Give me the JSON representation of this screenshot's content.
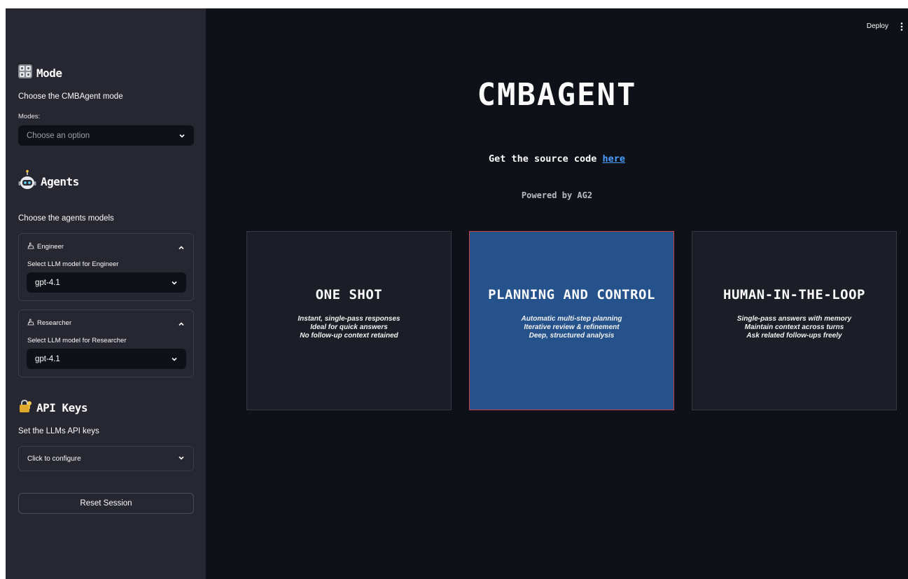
{
  "sidebar": {
    "mode": {
      "heading": "Mode",
      "description": "Choose the CMBAgent mode",
      "select_label": "Modes:",
      "select_placeholder": "Choose an option"
    },
    "agents": {
      "heading": "Agents",
      "description": "Choose the agents models",
      "engineer": {
        "title": "Engineer",
        "label": "Select LLM model for Engineer",
        "value": "gpt-4.1"
      },
      "researcher": {
        "title": "Researcher",
        "label": "Select LLM model for Researcher",
        "value": "gpt-4.1"
      }
    },
    "api_keys": {
      "heading": "API Keys",
      "description": "Set the LLMs API keys",
      "expander_label": "Click to configure"
    },
    "reset_label": "Reset Session"
  },
  "header": {
    "deploy_label": "Deploy"
  },
  "main": {
    "title": "CMBAGENT",
    "source_prefix": "Get the source code ",
    "source_link": "here",
    "powered": "Powered by AG2",
    "cards": [
      {
        "title": "ONE SHOT",
        "lines": [
          "Instant, single-pass responses",
          "Ideal for quick answers",
          "No follow-up context retained"
        ]
      },
      {
        "title": "PLANNING AND CONTROL",
        "lines": [
          "Automatic multi-step planning",
          "Iterative review & refinement",
          "Deep, structured analysis"
        ]
      },
      {
        "title": "HUMAN-IN-THE-LOOP",
        "lines": [
          "Single-pass answers with memory",
          "Maintain context across turns",
          "Ask related follow-ups freely"
        ]
      }
    ]
  },
  "colors": {
    "background": "#0e1117",
    "sidebar": "#262730",
    "card": "#1b1e26",
    "card_active": "#26528c",
    "link": "#4b9eff"
  },
  "icons": [
    "mode-icon",
    "robot-icon",
    "lock-icon",
    "chevron-down-icon",
    "chevron-up-icon",
    "menu-dots-icon"
  ]
}
